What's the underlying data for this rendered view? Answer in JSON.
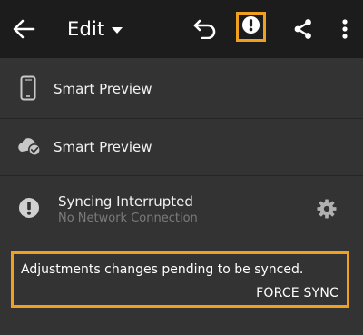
{
  "toolbar": {
    "back_icon": "arrow-left-icon",
    "edit_label": "Edit",
    "edit_dropdown_icon": "caret-down-icon",
    "undo_icon": "undo-icon",
    "alert_icon": "exclamation-circle-icon",
    "share_icon": "share-icon",
    "more_icon": "more-vertical-icon"
  },
  "rows": [
    {
      "icon": "phone-icon",
      "label": "Smart Preview"
    },
    {
      "icon": "cloud-check-icon",
      "label": "Smart Preview"
    },
    {
      "icon": "exclamation-circle-icon",
      "label": "Syncing Interrupted",
      "sublabel": "No Network Connection",
      "action_icon": "gear-icon"
    }
  ],
  "pending": {
    "message": "Adjustments changes pending to be synced.",
    "action_label": "FORCE SYNC"
  },
  "colors": {
    "toolbar_bg": "#1c1c1c",
    "panel_bg": "#333333",
    "highlight": "#f0a020",
    "icon": "#d0d0d0",
    "subtext": "#7b7b7b"
  }
}
